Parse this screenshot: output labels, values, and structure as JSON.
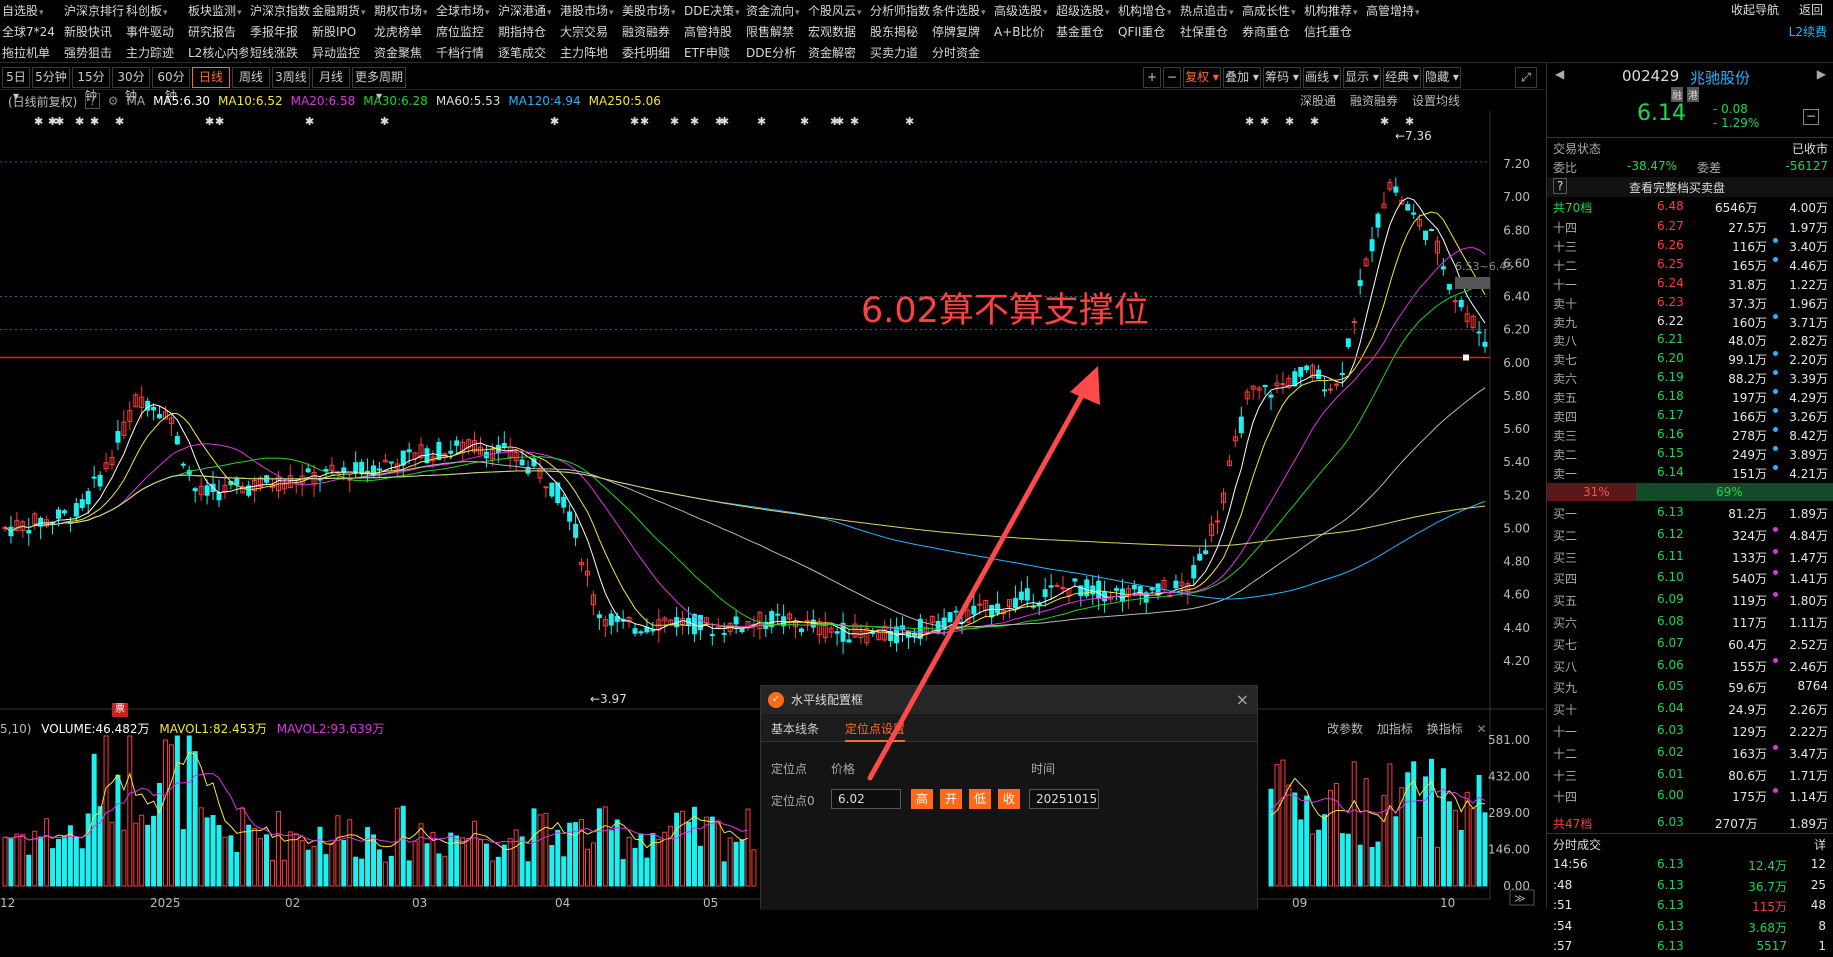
{
  "menu": {
    "row1": [
      "自选股",
      "沪深京排行",
      "科创板",
      "板块监测",
      "沪深京指数",
      "金融期货",
      "期权市场",
      "全球市场",
      "沪深港通",
      "港股市场",
      "美股市场",
      "DDE决策",
      "资金流向",
      "个股风云",
      "分析师指数",
      "条件选股",
      "高级选股",
      "超级选股",
      "机构增仓",
      "热点追击",
      "高成长性",
      "机构推荐",
      "高管增持"
    ],
    "row2": [
      "全球7*24",
      "新股快讯",
      "事件驱动",
      "研究报告",
      "季报年报",
      "新股IPO",
      "龙虎榜单",
      "席位监控",
      "期指持仓",
      "大宗交易",
      "融资融券",
      "高管持股",
      "限售解禁",
      "宏观数据",
      "股东揭秘",
      "停牌复牌",
      "A+B比价",
      "基金重仓",
      "QFII重仓",
      "社保重仓",
      "券商重仓",
      "信托重仓"
    ],
    "row3": [
      "拖拉机单",
      "强势狙击",
      "主力踪迹",
      "L2核心内参",
      "短线涨跌",
      "异动监控",
      "资金聚焦",
      "千档行情",
      "逐笔成交",
      "主力阵地",
      "委托明细",
      "ETF申赎",
      "DDE分析",
      "资金解密",
      "买卖力道",
      "分时资金"
    ],
    "right": [
      "收起导航",
      "返回"
    ],
    "l2": "L2续费"
  },
  "toolbar": {
    "periods": [
      "5日",
      "5分钟",
      "15分钟",
      "30分钟",
      "60分钟",
      "日线",
      "周线",
      "3周线",
      "月线",
      "更多周期"
    ],
    "active": "日线",
    "right": [
      "+",
      "−",
      "复权",
      "叠加",
      "筹码",
      "画线",
      "显示",
      "经典",
      "隐藏"
    ]
  },
  "ma_legend": {
    "prefix": "(日线前复权)",
    "ma": "MA",
    "ma5": "MA5:6.30",
    "ma10": "MA10:6.52",
    "ma20": "MA20:6.58",
    "ma30": "MA30:6.28",
    "ma60": "MA60:5.53",
    "ma120": "MA120:4.94",
    "ma250": "MA250:5.06",
    "links": [
      "深股通",
      "融资融券",
      "设置均线"
    ]
  },
  "colors": {
    "ma5": "#ffffff",
    "ma10": "#f6e636",
    "ma20": "#e033e0",
    "ma30": "#21d421",
    "ma60": "#b8b8b8",
    "ma120": "#27b4ff",
    "ma250": "#d9d36a",
    "up": "#ff3b3b",
    "down": "#1cf0f0"
  },
  "chart_data": {
    "type": "candlestick",
    "price_axis": [
      "7.20",
      "7.00",
      "6.80",
      "6.60",
      "6.40",
      "6.20",
      "6.00",
      "5.80",
      "5.60",
      "5.40",
      "5.20",
      "5.00",
      "4.80",
      "4.60",
      "4.40",
      "4.20"
    ],
    "price_range": [
      4.1,
      7.45
    ],
    "x_labels": [
      "12",
      "2025",
      "02",
      "03",
      "04",
      "05",
      "09",
      "10"
    ],
    "high_label": "7.36",
    "low_label": "3.97",
    "side_label": "6.53~6.45",
    "support_level": 6.02,
    "volume_axis": [
      "581.00",
      "432.00",
      "289.00",
      "146.00",
      "0.00"
    ],
    "volume_unit": "万"
  },
  "annotation": "6.02算不算支撑位",
  "volume_legend": {
    "prefix": "5,10)",
    "volume": "VOLUME:46.482万",
    "mavol1": "MAVOL1:82.453万",
    "mavol2": "MAVOL2:93.639万",
    "links": [
      "改参数",
      "加指标",
      "换指标"
    ],
    "badge": "票"
  },
  "dialog": {
    "title": "水平线配置框",
    "tabs": [
      "基本线条",
      "定位点设置"
    ],
    "headers": [
      "定位点",
      "价格",
      "时间"
    ],
    "row_label": "定位点0",
    "price": "6.02",
    "buttons": [
      "高",
      "开",
      "低",
      "收"
    ],
    "date": "20251015"
  },
  "quote": {
    "code": "002429",
    "name": "兆驰股份",
    "tags": [
      "融",
      "港"
    ],
    "price": "6.14",
    "change": "- 0.08",
    "change_pct": "- 1.29%",
    "status_label": "交易状态",
    "status": "已收市",
    "weibi_label": "委比",
    "weibi": "-38.47%",
    "weicha_label": "委差",
    "weicha": "-56127",
    "full_book": "查看完整档买卖盘",
    "sell_total_label": "共70档",
    "sell_total_price": "6.48",
    "sell_total_vol": "6546万",
    "sell_total_amt": "4.00万",
    "sell": [
      {
        "l": "十四",
        "p": "6.27",
        "v": "27.5万",
        "a": "1.97万",
        "c": "up",
        "d": ""
      },
      {
        "l": "十三",
        "p": "6.26",
        "v": "116万",
        "a": "3.40万",
        "c": "up",
        "d": "#27b4ff"
      },
      {
        "l": "十二",
        "p": "6.25",
        "v": "165万",
        "a": "4.46万",
        "c": "up",
        "d": "#27b4ff"
      },
      {
        "l": "十一",
        "p": "6.24",
        "v": "31.8万",
        "a": "1.22万",
        "c": "up",
        "d": ""
      },
      {
        "l": "卖十",
        "p": "6.23",
        "v": "37.3万",
        "a": "1.96万",
        "c": "up",
        "d": ""
      },
      {
        "l": "卖九",
        "p": "6.22",
        "v": "160万",
        "a": "3.71万",
        "c": "wh",
        "d": "#27b4ff"
      },
      {
        "l": "卖八",
        "p": "6.21",
        "v": "48.0万",
        "a": "2.82万",
        "c": "dn",
        "d": ""
      },
      {
        "l": "卖七",
        "p": "6.20",
        "v": "99.1万",
        "a": "2.20万",
        "c": "dn",
        "d": "#27b4ff"
      },
      {
        "l": "卖六",
        "p": "6.19",
        "v": "88.2万",
        "a": "3.39万",
        "c": "dn",
        "d": "#27b4ff"
      },
      {
        "l": "卖五",
        "p": "6.18",
        "v": "197万",
        "a": "4.29万",
        "c": "dn",
        "d": "#27b4ff"
      },
      {
        "l": "卖四",
        "p": "6.17",
        "v": "166万",
        "a": "3.26万",
        "c": "dn",
        "d": "#27b4ff"
      },
      {
        "l": "卖三",
        "p": "6.16",
        "v": "278万",
        "a": "8.42万",
        "c": "dn",
        "d": "#27b4ff"
      },
      {
        "l": "卖二",
        "p": "6.15",
        "v": "249万",
        "a": "3.89万",
        "c": "dn",
        "d": "#27b4ff"
      },
      {
        "l": "卖一",
        "p": "6.14",
        "v": "151万",
        "a": "4.21万",
        "c": "dn",
        "d": "#27b4ff"
      }
    ],
    "ratio_left": "31%",
    "ratio_right": "69%",
    "buy": [
      {
        "l": "买一",
        "p": "6.13",
        "v": "81.2万",
        "a": "1.89万",
        "c": "dn",
        "d": ""
      },
      {
        "l": "买二",
        "p": "6.12",
        "v": "324万",
        "a": "4.84万",
        "c": "dn",
        "d": "#e033e0"
      },
      {
        "l": "买三",
        "p": "6.11",
        "v": "133万",
        "a": "1.47万",
        "c": "dn",
        "d": "#e033e0"
      },
      {
        "l": "买四",
        "p": "6.10",
        "v": "540万",
        "a": "1.41万",
        "c": "dn",
        "d": "#e033e0"
      },
      {
        "l": "买五",
        "p": "6.09",
        "v": "119万",
        "a": "1.80万",
        "c": "dn",
        "d": "#e033e0"
      },
      {
        "l": "买六",
        "p": "6.08",
        "v": "117万",
        "a": "1.11万",
        "c": "dn",
        "d": ""
      },
      {
        "l": "买七",
        "p": "6.07",
        "v": "60.4万",
        "a": "2.52万",
        "c": "dn",
        "d": ""
      },
      {
        "l": "买八",
        "p": "6.06",
        "v": "155万",
        "a": "2.46万",
        "c": "dn",
        "d": "#e033e0"
      },
      {
        "l": "买九",
        "p": "6.05",
        "v": "59.6万",
        "a": "8764",
        "c": "dn",
        "d": ""
      },
      {
        "l": "买十",
        "p": "6.04",
        "v": "24.9万",
        "a": "2.26万",
        "c": "dn",
        "d": ""
      },
      {
        "l": "十一",
        "p": "6.03",
        "v": "129万",
        "a": "2.22万",
        "c": "dn",
        "d": ""
      },
      {
        "l": "十二",
        "p": "6.02",
        "v": "163万",
        "a": "3.47万",
        "c": "dn",
        "d": "#e033e0"
      },
      {
        "l": "十三",
        "p": "6.01",
        "v": "80.6万",
        "a": "1.71万",
        "c": "dn",
        "d": ""
      },
      {
        "l": "十四",
        "p": "6.00",
        "v": "175万",
        "a": "1.14万",
        "c": "dn",
        "d": "#e033e0"
      }
    ],
    "buy_total_label": "共47档",
    "buy_total_price": "6.03",
    "buy_total_vol": "2707万",
    "buy_total_amt": "1.89万",
    "ticks_label": "分时成交",
    "ticks_detail": "详",
    "ticks": [
      {
        "t": "14:56",
        "p": "6.13",
        "v": "12.4万",
        "n": "12",
        "vc": "dn"
      },
      {
        "t": ":48",
        "p": "6.13",
        "v": "36.7万",
        "n": "25",
        "vc": "dn"
      },
      {
        "t": ":51",
        "p": "6.13",
        "v": "115万",
        "n": "48",
        "vc": "up"
      },
      {
        "t": ":54",
        "p": "6.13",
        "v": "3.68万",
        "n": "8",
        "vc": "dn"
      },
      {
        "t": ":57",
        "p": "6.13",
        "v": "5517",
        "n": "1",
        "vc": "dn"
      }
    ]
  }
}
